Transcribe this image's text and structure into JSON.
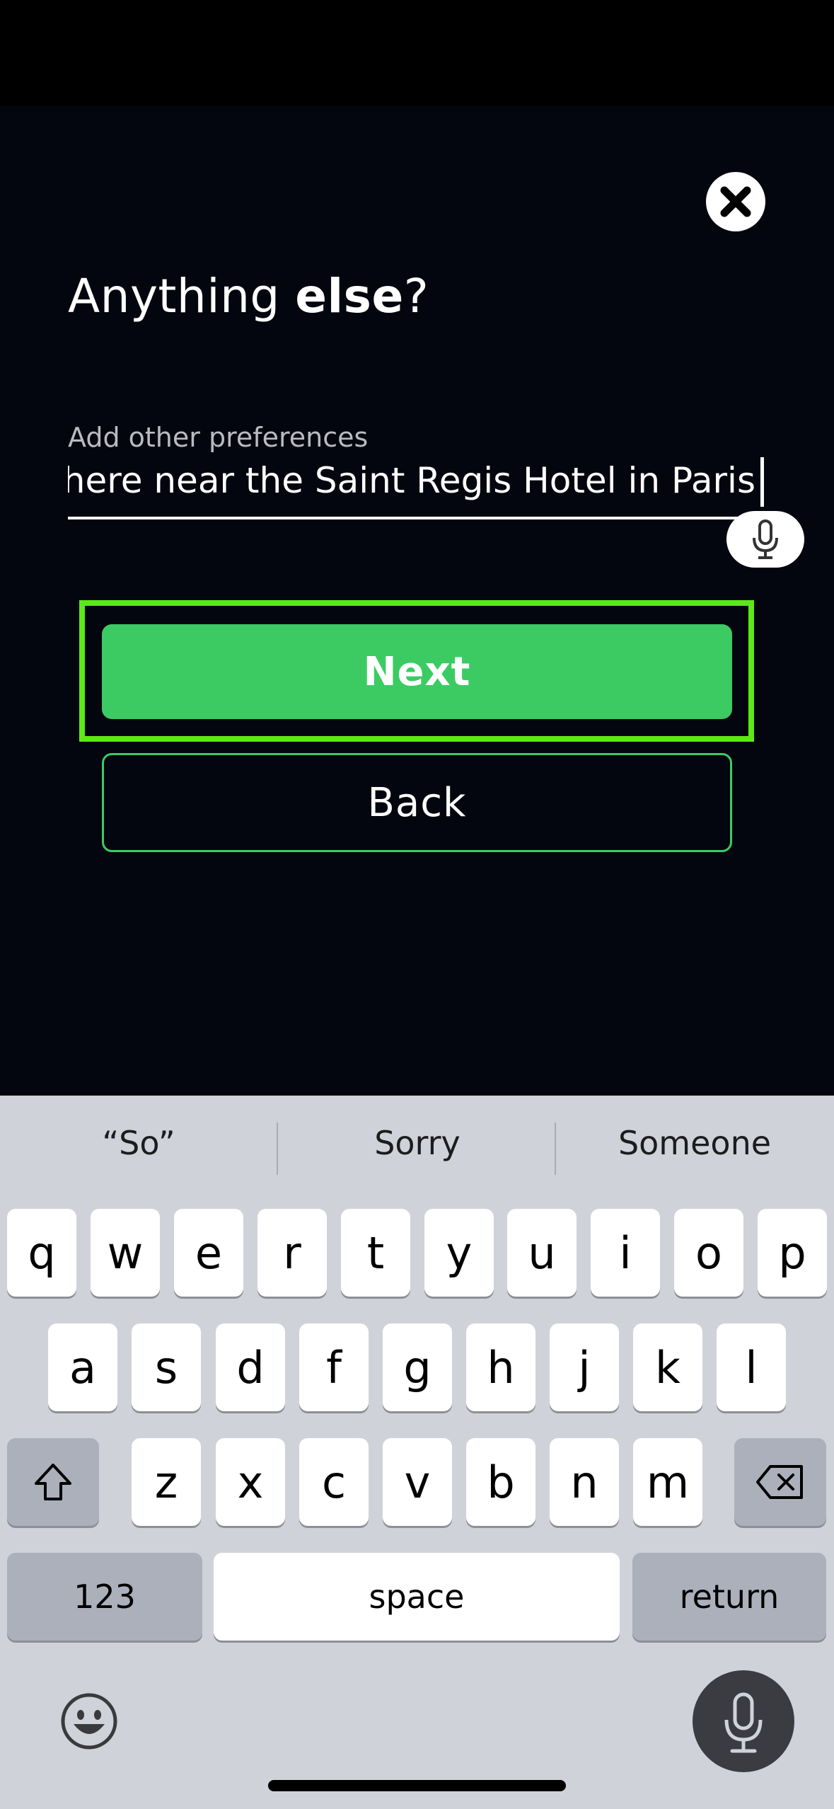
{
  "header": {
    "title_prefix": "Anything ",
    "title_bold": "else",
    "title_suffix": "?"
  },
  "preferences": {
    "label": "Add other preferences",
    "value": "where near the Saint Regis Hotel in Paris"
  },
  "actions": {
    "next_label": "Next",
    "back_label": "Back"
  },
  "keyboard": {
    "suggestions": [
      "“So”",
      "Sorry",
      "Someone"
    ],
    "row1": [
      "q",
      "w",
      "e",
      "r",
      "t",
      "y",
      "u",
      "i",
      "o",
      "p"
    ],
    "row2": [
      "a",
      "s",
      "d",
      "f",
      "g",
      "h",
      "j",
      "k",
      "l"
    ],
    "row3": [
      "z",
      "x",
      "c",
      "v",
      "b",
      "n",
      "m"
    ],
    "numbers_label": "123",
    "space_label": "space",
    "return_label": "return"
  },
  "colors": {
    "background": "#03060e",
    "accent_green": "#3ccb63",
    "highlight_frame": "#5bea17",
    "keyboard_bg": "#cfd2d9"
  },
  "icons": {
    "close": "close-icon",
    "mic": "microphone-icon",
    "shift": "shift-icon",
    "delete": "delete-icon",
    "emoji": "emoji-icon",
    "dictation": "dictation-mic-icon"
  }
}
